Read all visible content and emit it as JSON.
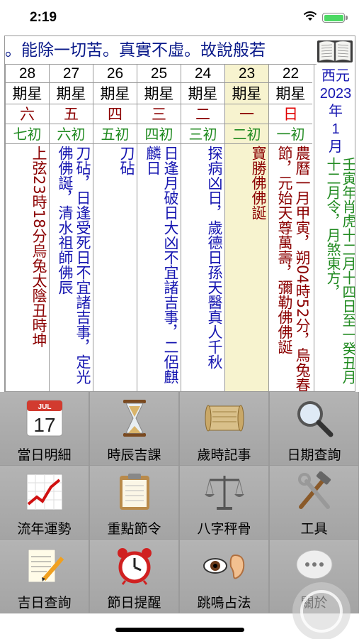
{
  "status": {
    "time": "2:19"
  },
  "marquee": "。能除一切苦。真實不虛。故說般若",
  "calendar": {
    "days": [
      {
        "date": "28",
        "week": "期星",
        "weekday": "六",
        "lunar": "七初",
        "event": "上弦23時18分烏兔太陰丑時坤",
        "color": "#8b0000"
      },
      {
        "date": "27",
        "week": "期星",
        "weekday": "五",
        "lunar": "六初",
        "event": "刀砧，日逢受死日不宜諸吉事，定光佛佛誕，清水祖師佛辰",
        "color": "#1515b0"
      },
      {
        "date": "26",
        "week": "期星",
        "weekday": "四",
        "lunar": "五初",
        "event": "刀砧",
        "color": "#1515b0"
      },
      {
        "date": "25",
        "week": "期星",
        "weekday": "三",
        "lunar": "四初",
        "event": "日逢月破日大凶不宜諸吉事，二侶麒麟日",
        "color": "#1515b0"
      },
      {
        "date": "24",
        "week": "期星",
        "weekday": "二",
        "lunar": "三初",
        "event": "探病凶日，歲德日孫天醫真人千秋",
        "color": "#1515b0"
      },
      {
        "date": "23",
        "week": "期星",
        "weekday": "一",
        "lunar": "二初",
        "event": "寶勝佛佛誕",
        "color": "#8b0000"
      },
      {
        "date": "22",
        "week": "期星",
        "weekday": "日",
        "lunar": "一初",
        "event": "農曆一月甲寅，朔04時52分，烏兔春節，元始天尊萬壽，彌勒佛佛誕",
        "color": "#8b0000"
      }
    ],
    "side": {
      "year_lines": [
        "西元",
        "2023",
        "年",
        "1",
        "月"
      ],
      "info": "壬寅年肖虎十二月十四日至一癸丑月十二月令，月煞東方，"
    }
  },
  "menu": {
    "items": [
      {
        "label": "當日明細",
        "icon": "calendar-17-icon"
      },
      {
        "label": "時辰吉課",
        "icon": "hourglass-icon"
      },
      {
        "label": "歲時記事",
        "icon": "scroll-icon"
      },
      {
        "label": "日期查詢",
        "icon": "magnifier-icon"
      },
      {
        "label": "流年運勢",
        "icon": "trend-chart-icon"
      },
      {
        "label": "重點節令",
        "icon": "clipboard-icon"
      },
      {
        "label": "八字秤骨",
        "icon": "scales-icon"
      },
      {
        "label": "工具",
        "icon": "tools-icon"
      },
      {
        "label": "吉日查詢",
        "icon": "notepad-pencil-icon"
      },
      {
        "label": "節日提醒",
        "icon": "alarm-clock-icon"
      },
      {
        "label": "跳鳴占法",
        "icon": "eye-ear-icon"
      },
      {
        "label": "關於",
        "icon": "more-bubble-icon"
      }
    ],
    "calendar_icon_month": "JUL",
    "calendar_icon_day": "17"
  }
}
